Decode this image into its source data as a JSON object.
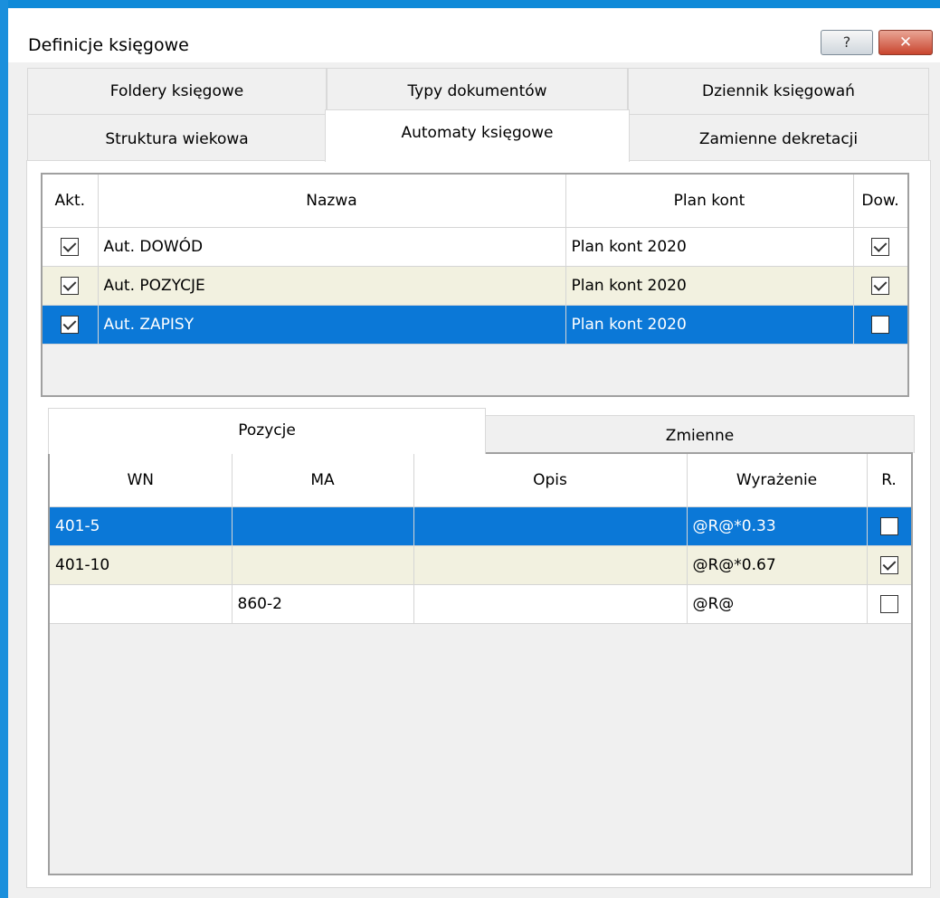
{
  "window": {
    "title": "Definicje księgowe",
    "help_glyph": "?",
    "close_glyph": "✕"
  },
  "tabs_row1": [
    "Foldery księgowe",
    "Typy dokumentów",
    "Dziennik księgowań"
  ],
  "tabs_row2": [
    "Struktura  wiekowa",
    "Automaty księgowe",
    "Zamienne dekretacji"
  ],
  "active_tab": "Automaty księgowe",
  "automaty": {
    "columns": [
      "Akt.",
      "Nazwa",
      "Plan kont",
      "Dow."
    ],
    "rows": [
      {
        "akt": true,
        "nazwa": "Aut. DOWÓD",
        "plan": "Plan kont 2020",
        "dow": true
      },
      {
        "akt": true,
        "nazwa": "Aut. POZYCJE",
        "plan": "Plan kont 2020",
        "dow": true
      },
      {
        "akt": true,
        "nazwa": "Aut. ZAPISY",
        "plan": "Plan kont 2020",
        "dow": false
      }
    ]
  },
  "inner_tabs": [
    "Pozycje",
    "Zmienne"
  ],
  "pozycje": {
    "columns": [
      "WN",
      "MA",
      "Opis",
      "Wyrażenie",
      "R."
    ],
    "rows": [
      {
        "wn": "401-5",
        "ma": "",
        "opis": "",
        "wyr": "@R@*0.33",
        "r": false
      },
      {
        "wn": "401-10",
        "ma": "",
        "opis": "",
        "wyr": "@R@*0.67",
        "r": true
      },
      {
        "wn": "",
        "ma": "860-2",
        "opis": "",
        "wyr": "@R@",
        "r": false
      }
    ]
  },
  "colors": {
    "selection": "#0b78d7",
    "alt_row": "#f2f1e0",
    "frame": "#0f8ad8"
  }
}
